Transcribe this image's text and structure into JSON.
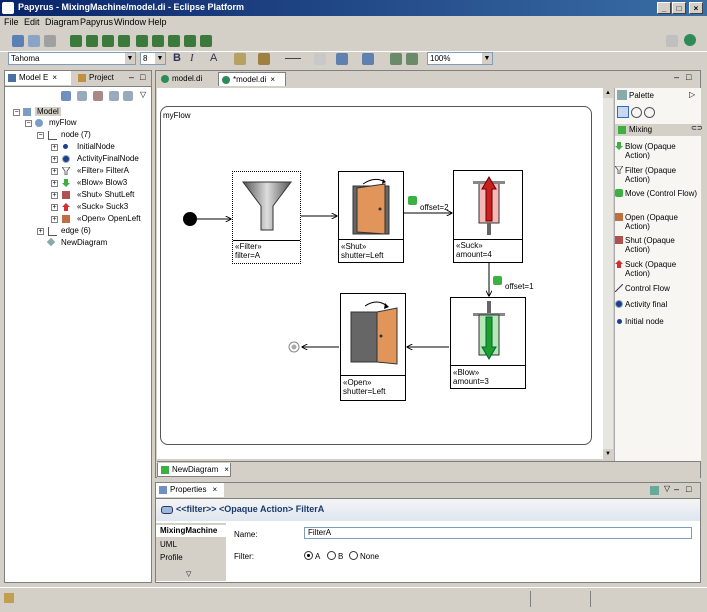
{
  "window": {
    "title": "Papyrus - MixingMachine/model.di - Eclipse Platform"
  },
  "menu": [
    "File",
    "Edit",
    "Diagram",
    "Papyrus",
    "Window",
    "Help"
  ],
  "toolbar": {
    "font": "Tahoma",
    "size": "8",
    "zoom": "100%",
    "bold": "B",
    "italic": "I",
    "font_color": "A"
  },
  "left_tabs": [
    {
      "label": "Model E"
    },
    {
      "label": "Project"
    }
  ],
  "tree": {
    "root": "Model",
    "flow": "myFlow",
    "node_group": "node (7)",
    "nodes": [
      {
        "label": "InitialNode"
      },
      {
        "label": "ActivityFinalNode"
      },
      {
        "label": "«Filter» FilterA"
      },
      {
        "label": "«Blow» Blow3"
      },
      {
        "label": "«Shut» ShutLeft"
      },
      {
        "label": "«Suck» Suck3"
      },
      {
        "label": "«Open» OpenLeft"
      }
    ],
    "edge_group": "edge (6)",
    "diagram": "NewDiagram"
  },
  "editor_tabs": [
    {
      "label": "model.di"
    },
    {
      "label": "*model.di"
    }
  ],
  "diagram": {
    "title": "myFlow",
    "nodes": {
      "filter": {
        "stereo": "«Filter»",
        "prop": "filter=A"
      },
      "shut": {
        "stereo": "«Shut»",
        "prop": "shutter=Left"
      },
      "suck": {
        "stereo": "«Suck»",
        "prop": "amount=4"
      },
      "blow": {
        "stereo": "«Blow»",
        "prop": "amount=3"
      },
      "open": {
        "stereo": "«Open»",
        "prop": "shutter=Left"
      }
    },
    "edge_labels": {
      "shut_suck": "offset=2",
      "suck_blow": "offset=1"
    }
  },
  "palette": {
    "title": "Palette",
    "drawer": "Mixing",
    "items": [
      {
        "label": "Blow (Opaque Action)",
        "icon": "blow-icon"
      },
      {
        "label": "Filter (Opaque Action)",
        "icon": "filter-icon"
      },
      {
        "label": "Move (Control Flow)",
        "icon": "move-icon"
      },
      {
        "label": "Open (Opaque Action)",
        "icon": "open-icon"
      },
      {
        "label": "Shut (Opaque Action)",
        "icon": "shut-icon"
      },
      {
        "label": "Suck (Opaque Action)",
        "icon": "suck-icon"
      },
      {
        "label": "Control Flow",
        "icon": "control-flow-icon"
      },
      {
        "label": "Activity final",
        "icon": "activity-final-icon"
      },
      {
        "label": "Initial node",
        "icon": "initial-node-icon"
      }
    ]
  },
  "diagram_tab": {
    "label": "NewDiagram"
  },
  "properties": {
    "tab": "Properties",
    "header": "<<filter>> <Opaque Action> FilterA",
    "sections": [
      "MixingMachine",
      "UML",
      "Profile"
    ],
    "name_label": "Name:",
    "name_value": "FilterA",
    "filter_label": "Filter:",
    "options": [
      "A",
      "B",
      "None"
    ],
    "selected": "A"
  },
  "colors": {
    "accent": "#0a246a",
    "selection": "#316ac5"
  }
}
